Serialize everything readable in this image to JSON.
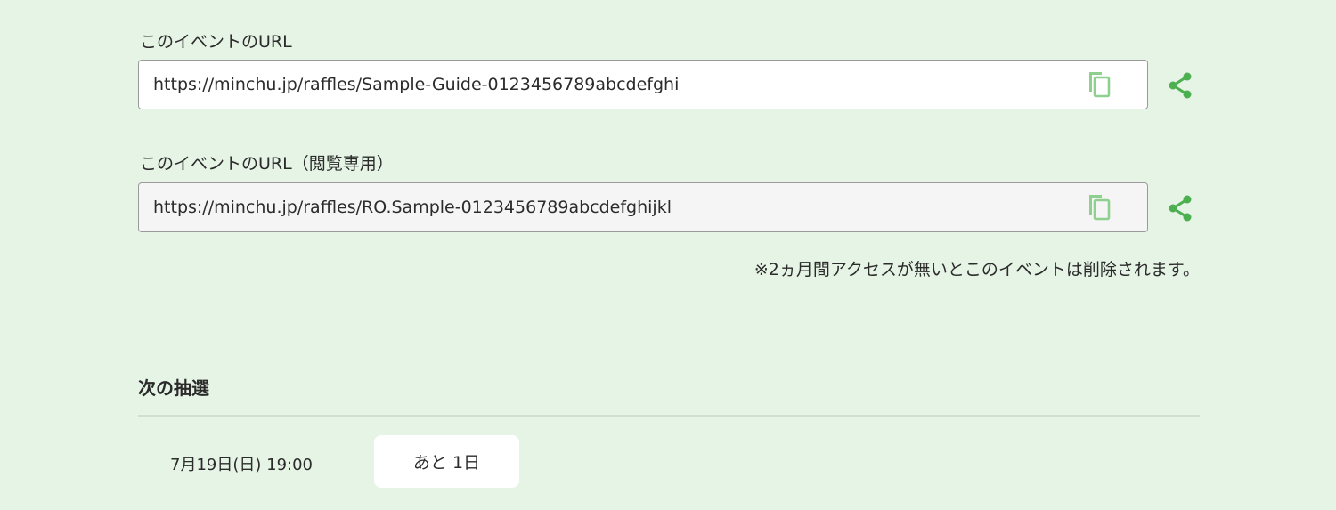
{
  "event_url": {
    "label": "このイベントのURL",
    "value": "https://minchu.jp/raffles/Sample-Guide-0123456789abcdefghi"
  },
  "readonly_url": {
    "label": "このイベントのURL（閲覧専用）",
    "value": "https://minchu.jp/raffles/RO.Sample-0123456789abcdefghijkl"
  },
  "notice": "※2ヵ月間アクセスが無いとこのイベントは削除されます。",
  "next_draw": {
    "title": "次の抽選",
    "date": "7月19日(日) 19:00",
    "remaining": "あと 1日"
  },
  "colors": {
    "background": "#e6f4e6",
    "accent_green": "#4caf50",
    "copy_icon": "#8fd08f"
  },
  "icons": {
    "copy": "copy-icon",
    "share": "share-icon"
  }
}
